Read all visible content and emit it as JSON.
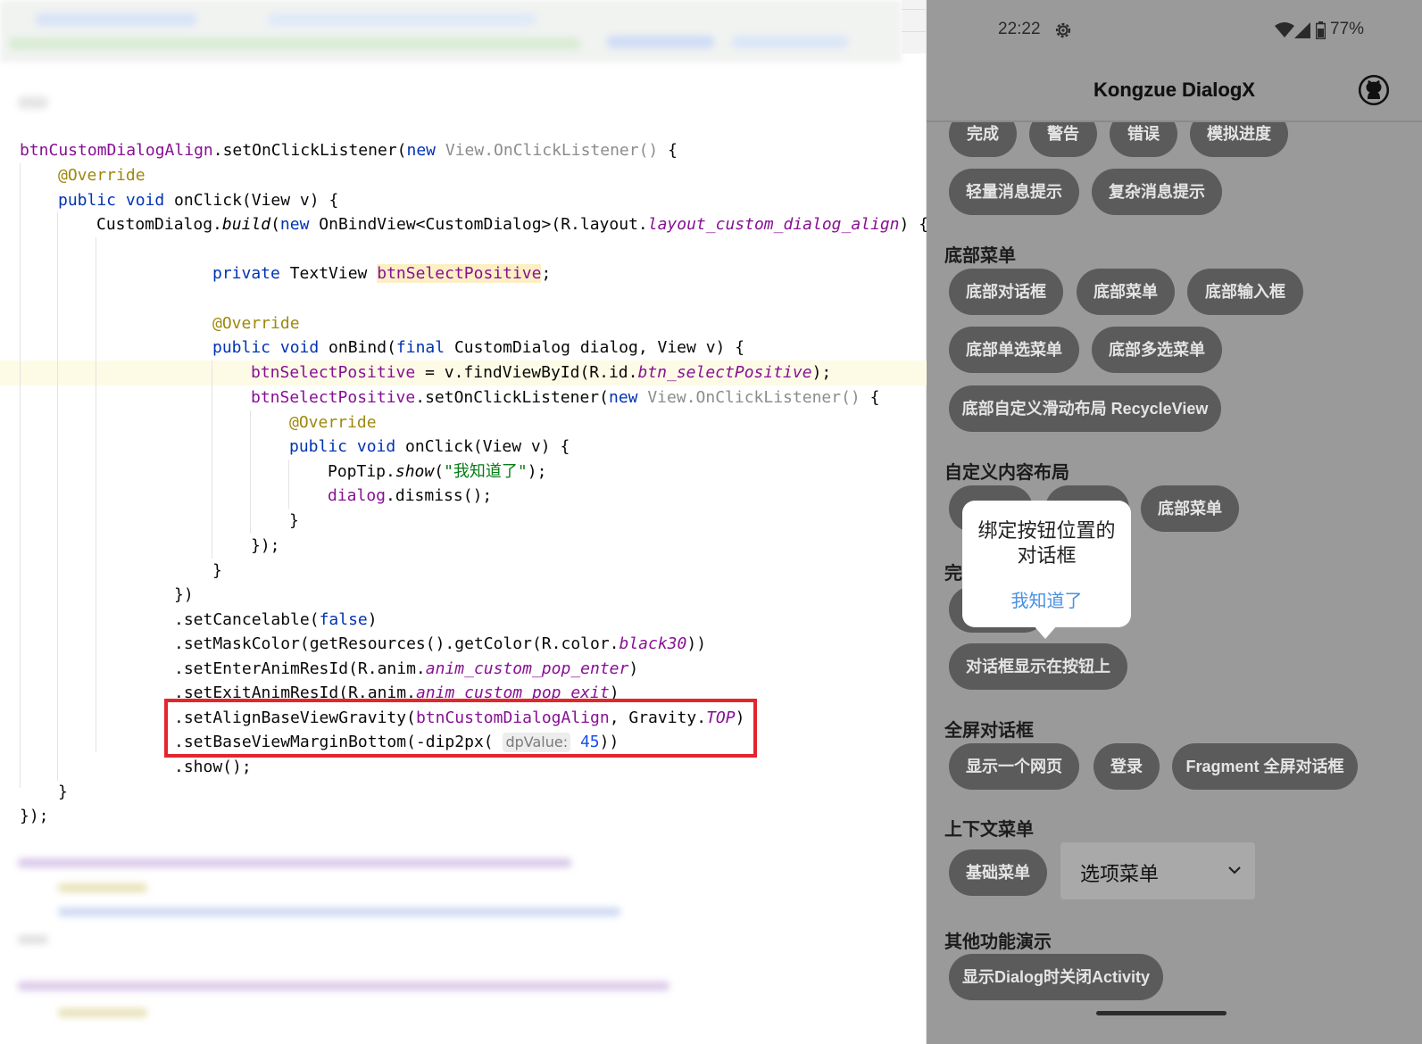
{
  "editor": {
    "lines": [
      {
        "t": [
          [
            "f",
            "btnCustomDialogAlign"
          ],
          [
            "",
            "."
          ],
          [
            "",
            "setOnClickListener("
          ],
          [
            "kw",
            "new "
          ],
          [
            "gr",
            "View.OnClickListener() "
          ],
          [
            "",
            "{"
          ]
        ]
      },
      {
        "t": [
          [
            "an",
            "@Override"
          ]
        ]
      },
      {
        "t": [
          [
            "kw",
            "public void "
          ],
          [
            "",
            "onClick(View v) {"
          ]
        ]
      },
      {
        "t": [
          [
            "",
            "CustomDialog."
          ],
          [
            "itb",
            "build"
          ],
          [
            "",
            "("
          ],
          [
            "kw",
            "new "
          ],
          [
            "",
            "OnBindView<CustomDialog>(R.layout."
          ],
          [
            "it",
            "layout_custom_dialog_align"
          ],
          [
            "",
            ") {"
          ]
        ]
      },
      {
        "t": [
          [
            "kw",
            "private "
          ],
          [
            "",
            "TextView "
          ],
          [
            "fh",
            "btnSelectPositive"
          ],
          [
            "",
            ";"
          ]
        ]
      },
      {
        "t": [
          [
            "an",
            "@Override"
          ]
        ]
      },
      {
        "t": [
          [
            "kw",
            "public void "
          ],
          [
            "",
            "onBind("
          ],
          [
            "kw",
            "final "
          ],
          [
            "",
            "CustomDialog dialog, View v) {"
          ]
        ]
      },
      {
        "t": [
          [
            "f",
            "btnSelectPositive"
          ],
          [
            "",
            " = v.findViewById(R.id."
          ],
          [
            "it",
            "btn_selectPositive"
          ],
          [
            "",
            ");"
          ]
        ]
      },
      {
        "t": [
          [
            "f",
            "btnSelectPositive"
          ],
          [
            "",
            ".setOnClickListener("
          ],
          [
            "kw",
            "new "
          ],
          [
            "gr",
            "View.OnClickListener() "
          ],
          [
            "",
            "{"
          ]
        ]
      },
      {
        "t": [
          [
            "an",
            "@Override"
          ]
        ]
      },
      {
        "t": [
          [
            "kw",
            "public void "
          ],
          [
            "",
            "onClick(View v) {"
          ]
        ]
      },
      {
        "t": [
          [
            "",
            "PopTip."
          ],
          [
            "itb",
            "show"
          ],
          [
            "",
            "("
          ],
          [
            "st",
            "\"我知道了\""
          ],
          [
            "",
            ");"
          ]
        ]
      },
      {
        "t": [
          [
            "f",
            "dialog"
          ],
          [
            "",
            ".dismiss();"
          ]
        ]
      },
      {
        "t": [
          [
            "",
            "}"
          ]
        ]
      },
      {
        "t": [
          [
            "",
            "});"
          ]
        ]
      },
      {
        "t": [
          [
            "",
            "}"
          ]
        ]
      },
      {
        "t": [
          [
            "",
            "})"
          ]
        ]
      },
      {
        "t": [
          [
            "",
            ".setCancelable("
          ],
          [
            "kw",
            "false"
          ],
          [
            "",
            ")"
          ]
        ]
      },
      {
        "t": [
          [
            "",
            ".setMaskColor(getResources().getColor(R.color."
          ],
          [
            "it",
            "black30"
          ],
          [
            "",
            "))"
          ]
        ]
      },
      {
        "t": [
          [
            "",
            ".setEnterAnimResId(R.anim."
          ],
          [
            "it",
            "anim_custom_pop_enter"
          ],
          [
            "",
            ")"
          ]
        ]
      },
      {
        "t": [
          [
            "",
            ".setExitAnimResId(R.anim."
          ],
          [
            "it",
            "anim_custom_pop_exit"
          ],
          [
            "",
            ")"
          ]
        ]
      },
      {
        "t": [
          [
            "",
            ".setAlignBaseViewGravity("
          ],
          [
            "f",
            "btnCustomDialogAlign"
          ],
          [
            "",
            ", Gravity."
          ],
          [
            "it",
            "TOP"
          ],
          [
            "",
            ")"
          ]
        ]
      },
      {
        "t": [
          [
            "",
            ".setBaseViewMarginBottom(-dip2px( "
          ],
          [
            "hint",
            "dpValue:"
          ],
          [
            "nm",
            " 45"
          ],
          [
            "",
            "))"
          ]
        ]
      },
      {
        "t": [
          [
            "",
            ".show();"
          ]
        ]
      },
      {
        "t": [
          [
            "",
            "}"
          ]
        ]
      },
      {
        "t": [
          [
            "",
            "});"
          ]
        ]
      }
    ]
  },
  "phone": {
    "status": {
      "time": "22:22",
      "battery": "77%"
    },
    "title": "Kongzue DialogX",
    "buttons_row1": [
      "完成",
      "警告",
      "错误",
      "模拟进度"
    ],
    "buttons_row2": [
      "轻量消息提示",
      "复杂消息提示"
    ],
    "section_bottom_menu": "底部菜单",
    "buttons_row3": [
      "底部对话框",
      "底部菜单",
      "底部输入框"
    ],
    "buttons_row4": [
      "底部单选菜单",
      "底部多选菜单"
    ],
    "buttons_row5": [
      "底部自定义滑动布局 RecycleView"
    ],
    "section_custom": "自定义内容布局",
    "buttons_row6_visible": "底部菜单",
    "section_partial": "完",
    "button_above": "对话框显示在按钮上",
    "section_fullscreen": "全屏对话框",
    "buttons_row8": [
      "显示一个网页",
      "登录",
      "Fragment 全屏对话框"
    ],
    "section_context": "上下文菜单",
    "button_basic_menu": "基础菜单",
    "select_value": "选项菜单",
    "section_other": "其他功能演示",
    "button_close_activity": "显示Dialog时关闭Activity",
    "tooltip": {
      "message": "绑定按钮位置的对话框",
      "action": "我知道了"
    },
    "colors": {
      "background": "#9a9a9a",
      "button": "#5b5b5b",
      "tooltip_action": "#4a90e2"
    }
  }
}
